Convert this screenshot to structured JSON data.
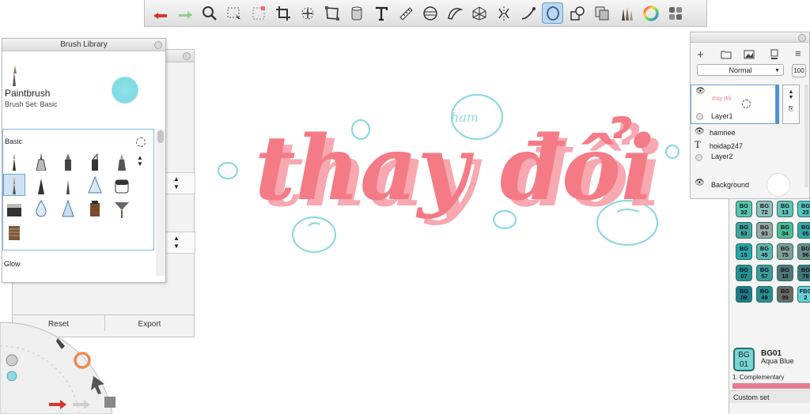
{
  "colors": {
    "lettering": "#f47b86",
    "lettering_shadow": "#f7a8b0",
    "bubble": "#8ed8e4",
    "accent_active": "#6b9fd1",
    "copic_teal": "#46b7b1"
  },
  "toolbar": {
    "icons": [
      "undo-icon",
      "redo-icon",
      "magnify-icon",
      "selection-icon",
      "crop-icon",
      "transform-icon",
      "stroke-icon",
      "ruler-icon",
      "text-icon",
      "ellipse-guide-icon",
      "symmetry-icon",
      "curve-icon",
      "perspective-icon",
      "steady-stroke-icon",
      "predictive-stroke-icon",
      "shape-icon",
      "layer-copy-icon",
      "brush-library-icon",
      "color-wheel-icon",
      "copic-library-icon"
    ]
  },
  "brush_library": {
    "title": "Brush Library",
    "brush_name": "Paintbrush",
    "brush_set": "Brush Set: Basic",
    "set_label": "Basic",
    "next_set_label": "Glow"
  },
  "behind_panel": {
    "reset_label": "Reset",
    "export_label": "Export"
  },
  "layers": {
    "blend_mode": "Normal",
    "opacity": "100",
    "items": [
      {
        "name": "Layer1",
        "thumb_text": "thay đổi"
      },
      {
        "name": "hamnee"
      },
      {
        "name": "hoidap247"
      },
      {
        "name": "Layer2"
      },
      {
        "name": "Background"
      }
    ]
  },
  "copic": {
    "swatches": [
      [
        "BG\n32",
        "BG\n72",
        "BG\n13",
        "BG\n23"
      ],
      [
        "BG\n53",
        "BG\n93",
        "BG\n34",
        "BG\n05"
      ],
      [
        "BG\n15",
        "BG\n45",
        "BG\n75",
        "BG\n96"
      ],
      [
        "BG\n07",
        "BG\n57",
        "BG\n18",
        "BG\n78"
      ],
      [
        "BG\n09",
        "BG\n49",
        "BG\n99",
        "FBG\n2"
      ]
    ],
    "selected_code_top": "BG",
    "selected_code_bottom": "01",
    "selected_id": "BG01",
    "selected_name": "Aqua Blue",
    "complementary_label": "1. Complementary",
    "custom_set_label": "Custom set"
  },
  "canvas": {
    "lettering_text": "thay đổi",
    "bubble_text": "ham"
  }
}
